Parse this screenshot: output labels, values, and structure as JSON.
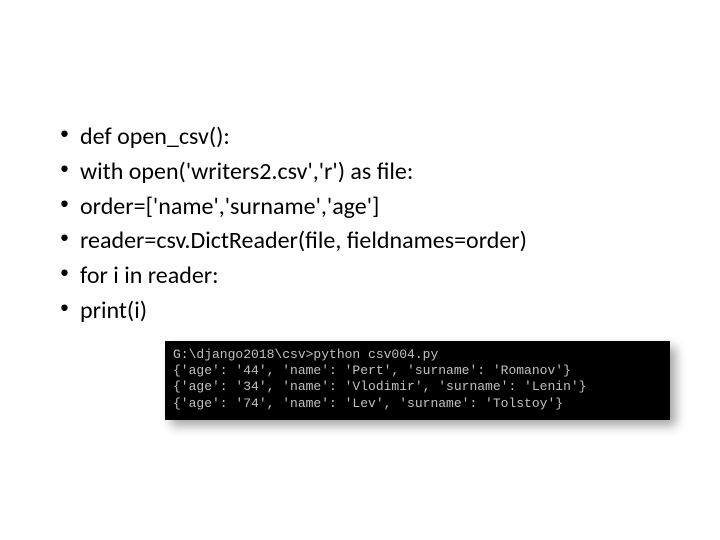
{
  "code": {
    "line1": "def open_csv():",
    "line2": " with open('writers2.csv','r') as file:",
    "line3": "        order=['name','surname','age']",
    "line4": "        reader=csv.DictReader(file, fieldnames=order)",
    "line5": "        for i in reader:",
    "line6": "             print(i)"
  },
  "terminal": {
    "line1": "G:\\django2018\\csv>python csv004.py",
    "line2": "{'age': '44', 'name': 'Pert', 'surname': 'Romanov'}",
    "line3": "{'age': '34', 'name': 'Vlodimir', 'surname': 'Lenin'}",
    "line4": "{'age': '74', 'name': 'Lev', 'surname': 'Tolstoy'}"
  }
}
